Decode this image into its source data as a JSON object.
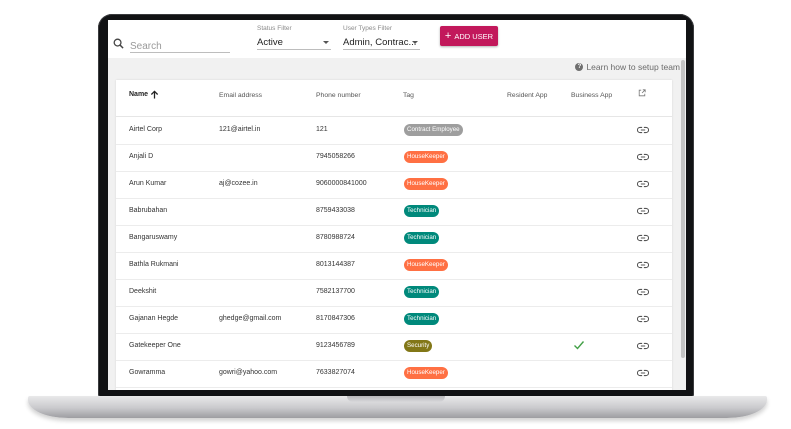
{
  "toolbar": {
    "search_placeholder": "Search",
    "status_filter": {
      "label": "Status Filter",
      "value": "Active"
    },
    "user_types_filter": {
      "label": "User Types Filter",
      "value": "Admin, Contrac..."
    },
    "add_user_label": "ADD USER",
    "add_user_color": "#c2185b"
  },
  "help": {
    "text": "Learn how to setup team",
    "icon": "help-circle-icon"
  },
  "table": {
    "columns": [
      "Name",
      "Email address",
      "Phone number",
      "Tag",
      "Resident App",
      "Business App"
    ],
    "sort": {
      "column": "Name",
      "direction": "ascending"
    },
    "rows": [
      {
        "name": "Airtel Corp",
        "email": "121@airtel.in",
        "phone": "121",
        "tag": "Contract Employee",
        "resident_app": false,
        "business_app": false
      },
      {
        "name": "Anjali D",
        "email": "",
        "phone": "7945058266",
        "tag": "HouseKeeper",
        "resident_app": false,
        "business_app": false
      },
      {
        "name": "Arun Kumar",
        "email": "aj@cozee.in",
        "phone": "9060000841000",
        "tag": "HouseKeeper",
        "resident_app": false,
        "business_app": false
      },
      {
        "name": "Babrubahan",
        "email": "",
        "phone": "8759433038",
        "tag": "Technician",
        "resident_app": false,
        "business_app": false
      },
      {
        "name": "Bangaruswamy",
        "email": "",
        "phone": "8780988724",
        "tag": "Technician",
        "resident_app": false,
        "business_app": false
      },
      {
        "name": "Bathla Rukmani",
        "email": "",
        "phone": "8013144387",
        "tag": "HouseKeeper",
        "resident_app": false,
        "business_app": false
      },
      {
        "name": "Deekshit",
        "email": "",
        "phone": "7582137700",
        "tag": "Technician",
        "resident_app": false,
        "business_app": false
      },
      {
        "name": "Gajanan Hegde",
        "email": "ghedge@gmail.com",
        "phone": "8170847306",
        "tag": "Technician",
        "resident_app": false,
        "business_app": false
      },
      {
        "name": "Gatekeeper One",
        "email": "",
        "phone": "9123456789",
        "tag": "Security",
        "resident_app": false,
        "business_app": true
      },
      {
        "name": "Gowramma",
        "email": "gowri@yahoo.com",
        "phone": "7633827074",
        "tag": "HouseKeeper",
        "resident_app": false,
        "business_app": false
      }
    ],
    "tag_colors": {
      "Contract Employee": "#9e9e9e",
      "HouseKeeper": "#ff7043",
      "Technician": "#00897b",
      "Security": "#827717"
    },
    "check_color": "#43a047"
  }
}
